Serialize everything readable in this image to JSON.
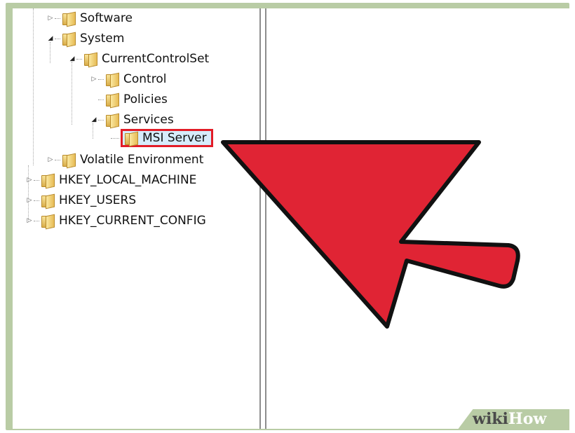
{
  "tree": {
    "items": [
      {
        "label": "Software",
        "toggle": "▷"
      },
      {
        "label": "System",
        "toggle": "◢"
      },
      {
        "label": "CurrentControlSet",
        "toggle": "◢"
      },
      {
        "label": "Control",
        "toggle": "▷"
      },
      {
        "label": "Policies",
        "toggle": ""
      },
      {
        "label": "Services",
        "toggle": "◢"
      },
      {
        "label": "MSI Server",
        "toggle": "",
        "selected": true
      },
      {
        "label": "Volatile Environment",
        "toggle": "▷"
      },
      {
        "label": "HKEY_LOCAL_MACHINE",
        "toggle": "▷"
      },
      {
        "label": "HKEY_USERS",
        "toggle": "▷"
      },
      {
        "label": "HKEY_CURRENT_CONFIG",
        "toggle": "▷"
      }
    ]
  },
  "annotation": {
    "arrow_color": "#e02434",
    "highlight_color": "#e21c27"
  },
  "watermark": {
    "wiki": "wiki",
    "how": "How"
  }
}
